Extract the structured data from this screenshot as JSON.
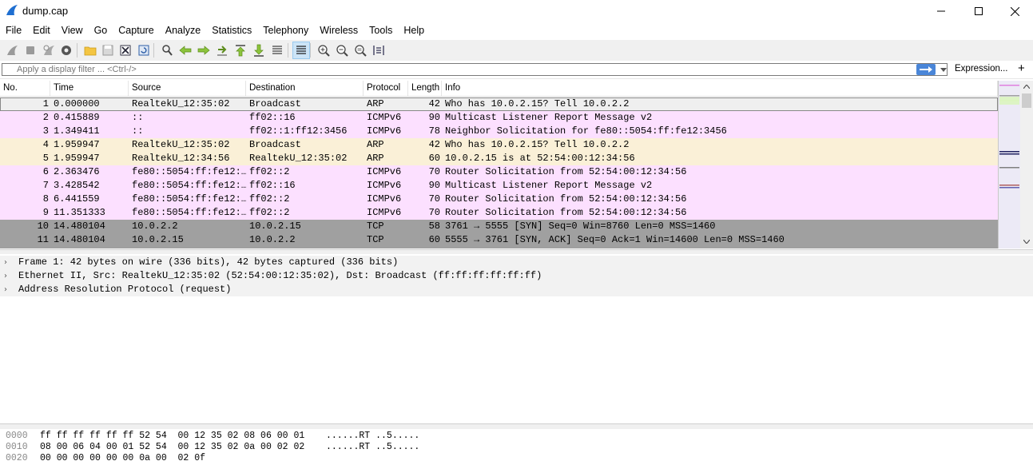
{
  "window": {
    "title": "dump.cap"
  },
  "menu": [
    "File",
    "Edit",
    "View",
    "Go",
    "Capture",
    "Analyze",
    "Statistics",
    "Telephony",
    "Wireless",
    "Tools",
    "Help"
  ],
  "toolbar": {
    "icons": [
      "shark-fin-start-icon",
      "stop-icon",
      "restart-icon",
      "options-gear-icon",
      "open-folder-icon",
      "save-file-icon",
      "close-file-icon",
      "reload-icon",
      "find-icon",
      "go-back-icon",
      "go-forward-icon",
      "go-to-packet-icon",
      "first-packet-icon",
      "last-packet-icon",
      "autoscroll-icon",
      "colorize-icon",
      "zoom-in-icon",
      "zoom-out-icon",
      "zoom-normal-icon",
      "resize-columns-icon"
    ]
  },
  "filter": {
    "placeholder": "Apply a display filter ... <Ctrl-/>",
    "expression_label": "Expression...",
    "add_label": "+"
  },
  "columns": [
    "No.",
    "Time",
    "Source",
    "Destination",
    "Protocol",
    "Length",
    "Info"
  ],
  "packets": [
    {
      "no": "1",
      "time": "0.000000",
      "src": "RealtekU_12:35:02",
      "dst": "Broadcast",
      "proto": "ARP",
      "len": "42",
      "info": "Who has 10.0.2.15? Tell 10.0.2.2",
      "bg": "#efefef",
      "fg": "#000000"
    },
    {
      "no": "2",
      "time": "0.415889",
      "src": "::",
      "dst": "ff02::16",
      "proto": "ICMPv6",
      "len": "90",
      "info": "Multicast Listener Report Message v2",
      "bg": "#fce0ff",
      "fg": "#000000"
    },
    {
      "no": "3",
      "time": "1.349411",
      "src": "::",
      "dst": "ff02::1:ff12:3456",
      "proto": "ICMPv6",
      "len": "78",
      "info": "Neighbor Solicitation for fe80::5054:ff:fe12:3456",
      "bg": "#fce0ff",
      "fg": "#000000"
    },
    {
      "no": "4",
      "time": "1.959947",
      "src": "RealtekU_12:35:02",
      "dst": "Broadcast",
      "proto": "ARP",
      "len": "42",
      "info": "Who has 10.0.2.15? Tell 10.0.2.2",
      "bg": "#faf0d7",
      "fg": "#000000"
    },
    {
      "no": "5",
      "time": "1.959947",
      "src": "RealtekU_12:34:56",
      "dst": "RealtekU_12:35:02",
      "proto": "ARP",
      "len": "60",
      "info": "10.0.2.15 is at 52:54:00:12:34:56",
      "bg": "#faf0d7",
      "fg": "#000000"
    },
    {
      "no": "6",
      "time": "2.363476",
      "src": "fe80::5054:ff:fe12:…",
      "dst": "ff02::2",
      "proto": "ICMPv6",
      "len": "70",
      "info": "Router Solicitation from 52:54:00:12:34:56",
      "bg": "#fce0ff",
      "fg": "#000000"
    },
    {
      "no": "7",
      "time": "3.428542",
      "src": "fe80::5054:ff:fe12:…",
      "dst": "ff02::16",
      "proto": "ICMPv6",
      "len": "90",
      "info": "Multicast Listener Report Message v2",
      "bg": "#fce0ff",
      "fg": "#000000"
    },
    {
      "no": "8",
      "time": "6.441559",
      "src": "fe80::5054:ff:fe12:…",
      "dst": "ff02::2",
      "proto": "ICMPv6",
      "len": "70",
      "info": "Router Solicitation from 52:54:00:12:34:56",
      "bg": "#fce0ff",
      "fg": "#000000"
    },
    {
      "no": "9",
      "time": "11.351333",
      "src": "fe80::5054:ff:fe12:…",
      "dst": "ff02::2",
      "proto": "ICMPv6",
      "len": "70",
      "info": "Router Solicitation from 52:54:00:12:34:56",
      "bg": "#fce0ff",
      "fg": "#000000"
    },
    {
      "no": "10",
      "time": "14.480104",
      "src": "10.0.2.2",
      "dst": "10.0.2.15",
      "proto": "TCP",
      "len": "58",
      "info": "3761 → 5555 [SYN] Seq=0 Win=8760 Len=0 MSS=1460",
      "bg": "#a0a0a0",
      "fg": "#000000"
    },
    {
      "no": "11",
      "time": "14.480104",
      "src": "10.0.2.15",
      "dst": "10.0.2.2",
      "proto": "TCP",
      "len": "60",
      "info": "5555 → 3761 [SYN, ACK] Seq=0 Ack=1 Win=14600 Len=0 MSS=1460",
      "bg": "#a0a0a0",
      "fg": "#000000"
    }
  ],
  "details": [
    "Frame 1: 42 bytes on wire (336 bits), 42 bytes captured (336 bits)",
    "Ethernet II, Src: RealtekU_12:35:02 (52:54:00:12:35:02), Dst: Broadcast (ff:ff:ff:ff:ff:ff)",
    "Address Resolution Protocol (request)"
  ],
  "bytes": [
    {
      "off": "0000",
      "hex": "ff ff ff ff ff ff 52 54  00 12 35 02 08 06 00 01",
      "ascii": "......RT ..5....."
    },
    {
      "off": "0010",
      "hex": "08 00 06 04 00 01 52 54  00 12 35 02 0a 00 02 02",
      "ascii": "......RT ..5....."
    },
    {
      "off": "0020",
      "hex": "00 00 00 00 00 00 0a 00  02 0f",
      "ascii": ""
    }
  ]
}
